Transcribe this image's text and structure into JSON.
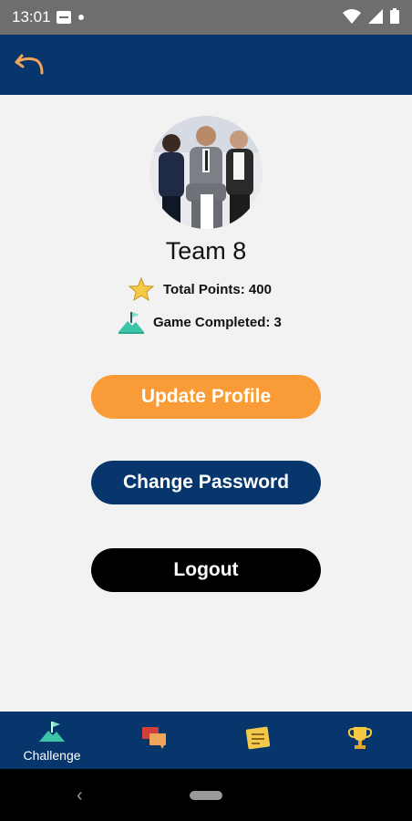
{
  "status_bar": {
    "time": "13:01"
  },
  "profile": {
    "team_name": "Team 8",
    "total_points_text": "Total Points: 400",
    "game_completed_text": "Game Completed: 3"
  },
  "actions": {
    "update_profile": "Update Profile",
    "change_password": "Change Password",
    "logout": "Logout"
  },
  "bottom_nav": {
    "items": [
      {
        "label": "Challenge",
        "icon": "challenge-flag-icon"
      },
      {
        "label": "",
        "icon": "chat-icon"
      },
      {
        "label": "",
        "icon": "notes-icon"
      },
      {
        "label": "",
        "icon": "trophy-icon"
      }
    ]
  },
  "colors": {
    "primary_navy": "#06366b",
    "accent_orange": "#f99c38",
    "status_gray": "#6e6e6e"
  }
}
